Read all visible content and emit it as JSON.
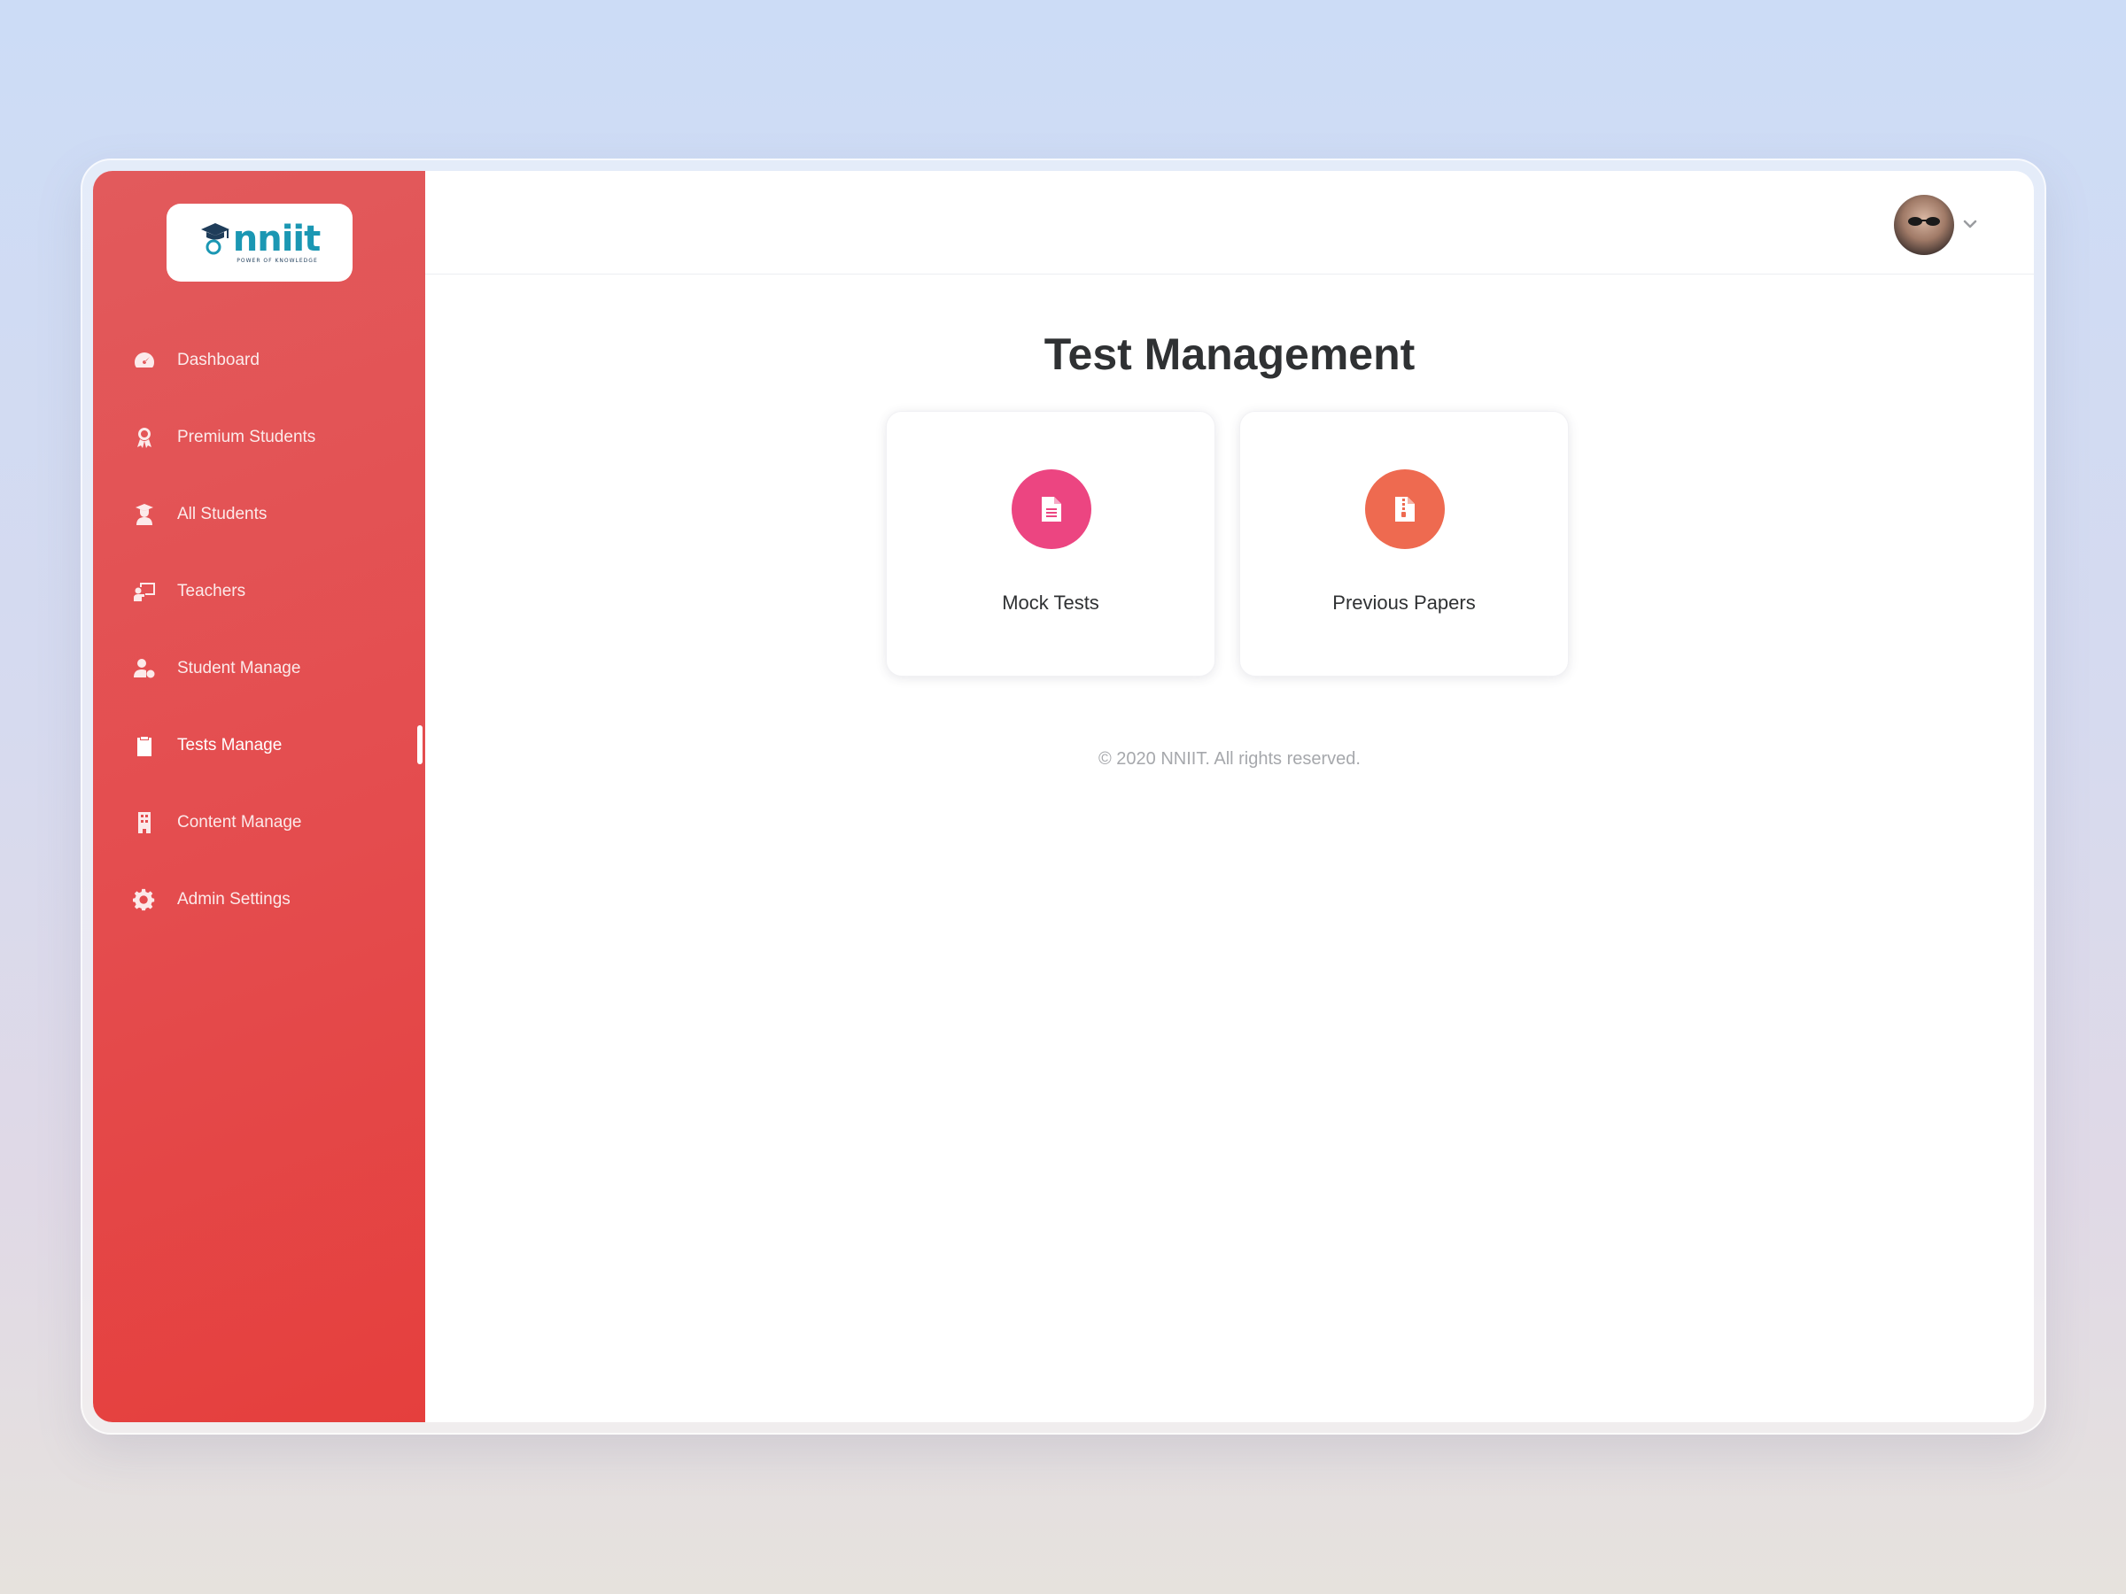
{
  "brand": {
    "logo_text": "nniit",
    "tagline": "POWER OF KNOWLEDGE",
    "accent": "#1b97b3",
    "sidebar_color": "#e44c4e"
  },
  "sidebar": {
    "items": [
      {
        "label": "Dashboard",
        "icon": "gauge-icon"
      },
      {
        "label": "Premium Students",
        "icon": "award-icon"
      },
      {
        "label": "All Students",
        "icon": "graduate-icon"
      },
      {
        "label": "Teachers",
        "icon": "teacher-icon"
      },
      {
        "label": "Student Manage",
        "icon": "user-gear-icon"
      },
      {
        "label": "Tests Manage",
        "icon": "clipboard-icon",
        "active": true
      },
      {
        "label": "Content Manage",
        "icon": "building-icon"
      },
      {
        "label": "Admin Settings",
        "icon": "gear-icon"
      }
    ]
  },
  "header": {
    "avatar": "user-avatar",
    "dropdown_icon": "chevron-down-icon"
  },
  "main": {
    "title": "Test Management",
    "cards": [
      {
        "label": "Mock Tests",
        "icon": "document-icon",
        "color": "#ec4581"
      },
      {
        "label": "Previous Papers",
        "icon": "archive-file-icon",
        "color": "#ee6a50"
      }
    ],
    "footer": "© 2020 NNIIT. All rights reserved."
  }
}
